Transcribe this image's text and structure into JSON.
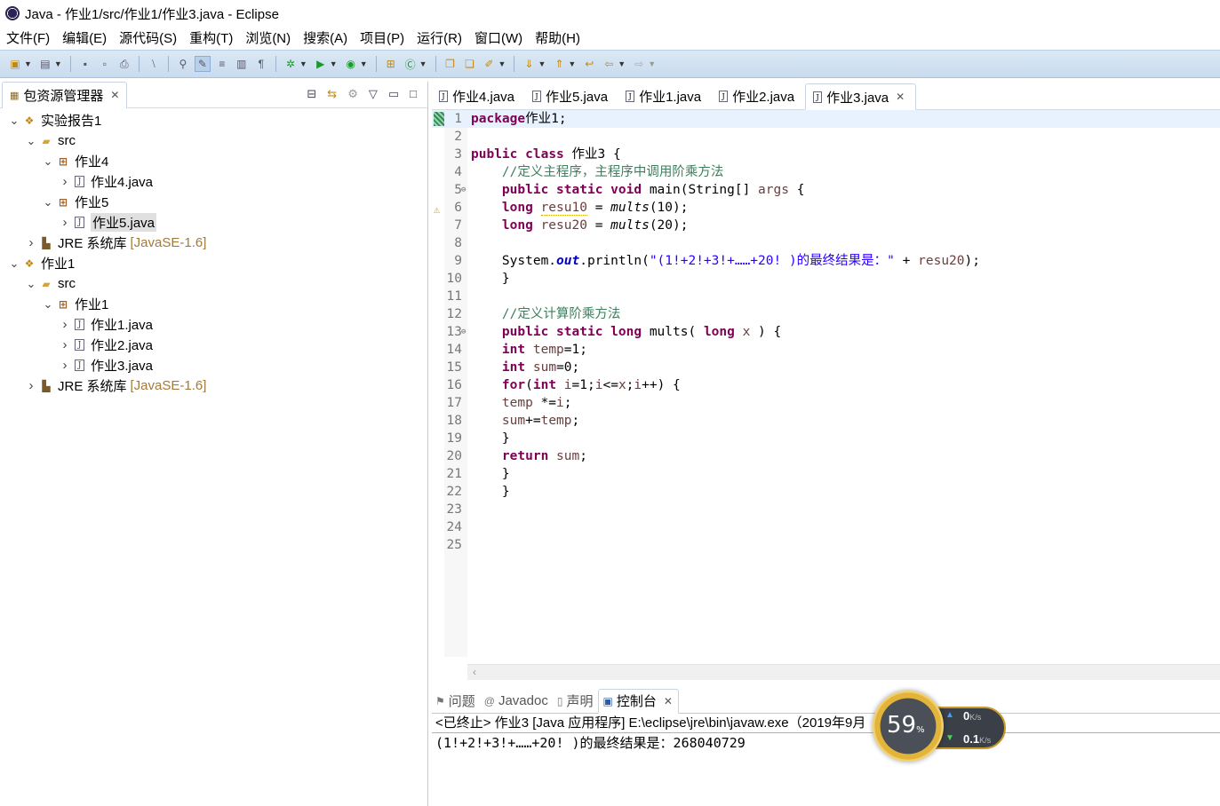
{
  "window": {
    "title": "Java  -  作业1/src/作业1/作业3.java  -  Eclipse"
  },
  "menu": [
    "文件(F)",
    "编辑(E)",
    "源代码(S)",
    "重构(T)",
    "浏览(N)",
    "搜索(A)",
    "项目(P)",
    "运行(R)",
    "窗口(W)",
    "帮助(H)"
  ],
  "explorer": {
    "title": "包资源管理器",
    "tree": [
      {
        "label": "实验报告1",
        "level": 0,
        "expanded": true,
        "icon": "project-icon"
      },
      {
        "label": "src",
        "level": 1,
        "expanded": true,
        "icon": "source-folder-icon"
      },
      {
        "label": "作业4",
        "level": 2,
        "expanded": true,
        "icon": "package-icon"
      },
      {
        "label": "作业4.java",
        "level": 3,
        "expanded": false,
        "icon": "java-file-icon"
      },
      {
        "label": "作业5",
        "level": 2,
        "expanded": true,
        "icon": "package-icon"
      },
      {
        "label": "作业5.java",
        "level": 3,
        "expanded": false,
        "icon": "java-file-icon",
        "selected": true
      },
      {
        "label": "JRE 系统库",
        "decor": "[JavaSE-1.6]",
        "level": 1,
        "expanded": false,
        "icon": "library-icon"
      },
      {
        "label": "作业1",
        "level": 0,
        "expanded": true,
        "icon": "project-icon"
      },
      {
        "label": "src",
        "level": 1,
        "expanded": true,
        "icon": "source-folder-icon"
      },
      {
        "label": "作业1",
        "level": 2,
        "expanded": true,
        "icon": "package-icon"
      },
      {
        "label": "作业1.java",
        "level": 3,
        "expanded": false,
        "icon": "java-file-icon"
      },
      {
        "label": "作业2.java",
        "level": 3,
        "expanded": false,
        "icon": "java-file-icon"
      },
      {
        "label": "作业3.java",
        "level": 3,
        "expanded": false,
        "icon": "java-file-icon"
      },
      {
        "label": "JRE 系统库",
        "decor": "[JavaSE-1.6]",
        "level": 1,
        "expanded": false,
        "icon": "library-icon"
      }
    ]
  },
  "editor": {
    "tabs": [
      {
        "label": "作业4.java",
        "active": false
      },
      {
        "label": "作业5.java",
        "active": false
      },
      {
        "label": "作业1.java",
        "active": false
      },
      {
        "label": "作业2.java",
        "active": false
      },
      {
        "label": "作业3.java",
        "active": true
      }
    ],
    "lines": [
      [
        [
          "kw",
          "package"
        ],
        [
          "",
          "作业1;"
        ]
      ],
      [],
      [
        [
          "kw",
          "public"
        ],
        [
          "",
          " "
        ],
        [
          "kw",
          "class"
        ],
        [
          "",
          " 作业3 {"
        ]
      ],
      [
        [
          "",
          " "
        ],
        [
          "cm",
          "   //定义主程序，主程序中调用阶乘方法"
        ]
      ],
      [
        [
          "",
          "    "
        ],
        [
          "kw",
          "public"
        ],
        [
          "",
          " "
        ],
        [
          "kw",
          "static"
        ],
        [
          "",
          " "
        ],
        [
          "kw",
          "void"
        ],
        [
          "",
          " main(String[] "
        ],
        [
          "var",
          "args"
        ],
        [
          "",
          " {"
        ]
      ],
      [
        [
          "",
          "    "
        ],
        [
          "kw",
          "long"
        ],
        [
          "",
          " "
        ],
        [
          "var warn-under",
          "resu10"
        ],
        [
          "",
          " = "
        ],
        [
          "it",
          "mults"
        ],
        [
          "",
          "(10);"
        ]
      ],
      [
        [
          "",
          "    "
        ],
        [
          "kw",
          "long"
        ],
        [
          "",
          " "
        ],
        [
          "var",
          "resu20"
        ],
        [
          "",
          " = "
        ],
        [
          "it",
          "mults"
        ],
        [
          "",
          "(20);"
        ]
      ],
      [],
      [
        [
          "",
          "    System."
        ],
        [
          "fld",
          "out"
        ],
        [
          "",
          ".println("
        ],
        [
          "str",
          "\"(1!+2!+3!+……+20! )的最终结果是：\""
        ],
        [
          "",
          " + "
        ],
        [
          "var",
          "resu20"
        ],
        [
          "",
          ");"
        ]
      ],
      [
        [
          "",
          "    }"
        ]
      ],
      [],
      [
        [
          "cm",
          "    //定义计算阶乘方法"
        ]
      ],
      [
        [
          "",
          "    "
        ],
        [
          "kw",
          "public"
        ],
        [
          "",
          " "
        ],
        [
          "kw",
          "static"
        ],
        [
          "",
          " "
        ],
        [
          "kw",
          "long"
        ],
        [
          "",
          " mults( "
        ],
        [
          "kw",
          "long"
        ],
        [
          "",
          " "
        ],
        [
          "var",
          "x"
        ],
        [
          "",
          " ) {"
        ]
      ],
      [
        [
          "",
          "    "
        ],
        [
          "kw",
          "int"
        ],
        [
          "",
          " "
        ],
        [
          "var",
          "temp"
        ],
        [
          "",
          "=1;"
        ]
      ],
      [
        [
          "",
          "    "
        ],
        [
          "kw",
          "int"
        ],
        [
          "",
          " "
        ],
        [
          "var",
          "sum"
        ],
        [
          "",
          "=0;"
        ]
      ],
      [
        [
          "",
          "    "
        ],
        [
          "kw",
          "for"
        ],
        [
          "",
          "("
        ],
        [
          "kw",
          "int"
        ],
        [
          "",
          " "
        ],
        [
          "var",
          "i"
        ],
        [
          "",
          "=1;"
        ],
        [
          "var",
          "i"
        ],
        [
          "",
          "<="
        ],
        [
          "var",
          "x"
        ],
        [
          "",
          ";"
        ],
        [
          "var",
          "i"
        ],
        [
          "",
          "++) {"
        ]
      ],
      [
        [
          "",
          "    "
        ],
        [
          "var",
          "temp"
        ],
        [
          "",
          " *="
        ],
        [
          "var",
          "i"
        ],
        [
          "",
          ";"
        ]
      ],
      [
        [
          "",
          "    "
        ],
        [
          "var",
          "sum"
        ],
        [
          "",
          "+="
        ],
        [
          "var",
          "temp"
        ],
        [
          "",
          ";"
        ]
      ],
      [
        [
          "",
          "    }"
        ]
      ],
      [
        [
          "",
          "    "
        ],
        [
          "kw",
          "return"
        ],
        [
          "",
          " "
        ],
        [
          "var",
          "sum"
        ],
        [
          "",
          ";"
        ]
      ],
      [
        [
          "",
          "    }"
        ]
      ],
      [
        [
          "",
          "    }"
        ]
      ],
      [],
      [],
      []
    ],
    "line_numbers": [
      "1",
      "2",
      "3",
      "4",
      "5",
      "6",
      "7",
      "8",
      "9",
      "10",
      "11",
      "12",
      "13",
      "14",
      "15",
      "16",
      "17",
      "18",
      "19",
      "20",
      "21",
      "22",
      "23",
      "24",
      "25"
    ]
  },
  "bottom": {
    "tabs": [
      {
        "label": "问题",
        "active": false,
        "icon": "problems-icon"
      },
      {
        "label": "Javadoc",
        "active": false,
        "icon": "javadoc-icon"
      },
      {
        "label": "声明",
        "active": false,
        "icon": "declaration-icon"
      },
      {
        "label": "控制台",
        "active": true,
        "icon": "console-icon"
      }
    ],
    "console_header": "<已终止> 作业3 [Java 应用程序] E:\\eclipse\\jre\\bin\\javaw.exe（2019年9月",
    "console_output": "(1!+2!+3!+……+20! )的最终结果是：268040729"
  },
  "net_widget": {
    "percent": "59",
    "percent_unit": "%",
    "up": "0",
    "down": "0.1",
    "unit": "K/s"
  }
}
